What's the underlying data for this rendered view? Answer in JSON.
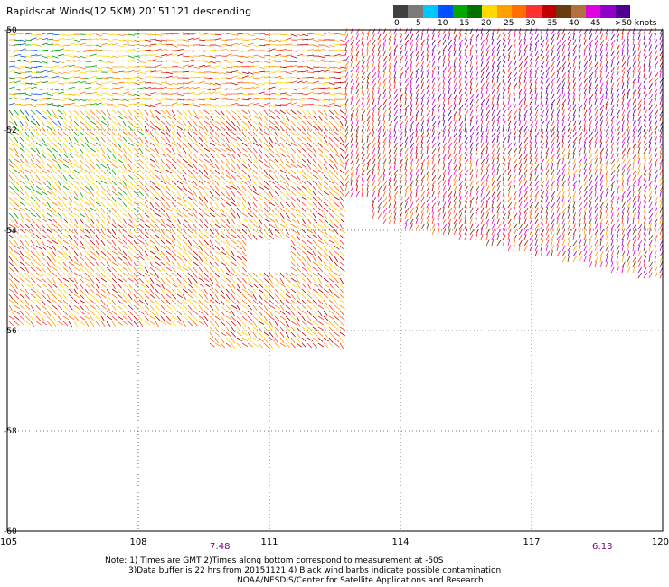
{
  "title": "Rapidscat Winds(12.5KM) 20151121 descending",
  "legend": {
    "colors": [
      "#404040",
      "#7a7a7a",
      "#00c8ff",
      "#0050ff",
      "#00a800",
      "#007000",
      "#ffd800",
      "#ffa000",
      "#ff7000",
      "#ff3030",
      "#c00000",
      "#6a3a10",
      "#b07040",
      "#e000e0",
      "#9000c8",
      "#500090"
    ],
    "labels": [
      "0",
      "5",
      "10",
      "15",
      "20",
      "25",
      "30",
      "35",
      "40",
      "45",
      ">50 knots"
    ]
  },
  "map": {
    "x_ticks": [
      "105",
      "108",
      "111",
      "114",
      "117",
      "120"
    ],
    "y_ticks": [
      "-50",
      "-52",
      "-54",
      "-56",
      "-58",
      "-60"
    ],
    "lon_range": [
      105,
      120
    ],
    "lat_range": [
      -60,
      -50
    ]
  },
  "times": {
    "left": "7:48",
    "right": "6:13"
  },
  "notes": {
    "line1": "Note: 1) Times are GMT 2)Times along bottom correspond to measurement at -50S",
    "line2": "3)Data buffer is 22 hrs from 20151121 4) Black wind barbs indicate possible contamination",
    "line3": "NOAA/NESDIS/Center for Satellite Applications and Research"
  }
}
